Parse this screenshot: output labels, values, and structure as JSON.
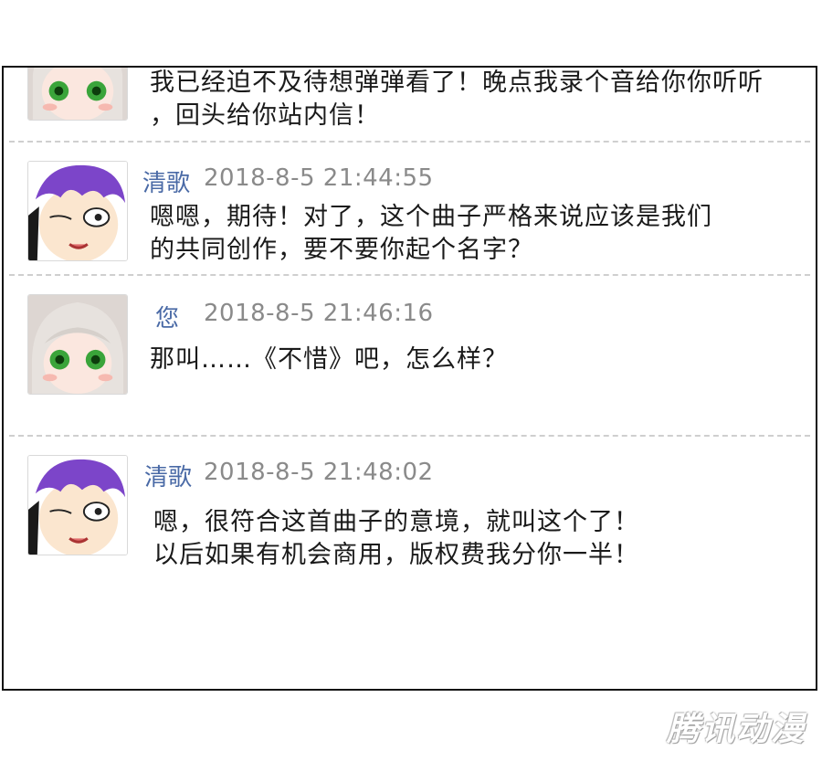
{
  "messages": [
    {
      "sender": "",
      "time": "",
      "avatar": "user-avatar",
      "lines": [
        "我已经迫不及待想弹弹看了！晚点我录个音给你你听听",
        "，回头给你站内信！"
      ]
    },
    {
      "sender": "清歌",
      "time": "2018-8-5 21:44:55",
      "avatar": "qingge-avatar",
      "lines": [
        "嗯嗯，期待！对了，这个曲子严格来说应该是我们",
        "的共同创作，要不要你起个名字？"
      ]
    },
    {
      "sender": "您",
      "time": "2018-8-5 21:46:16",
      "avatar": "user-avatar",
      "lines": [
        "那叫……《不惜》吧，怎么样？"
      ]
    },
    {
      "sender": "清歌",
      "time": "2018-8-5 21:48:02",
      "avatar": "qingge-avatar",
      "lines": [
        "嗯，很符合这首曲子的意境，就叫这个了！",
        "以后如果有机会商用，版权费我分你一半！"
      ]
    }
  ],
  "watermark": "腾讯动漫",
  "colors": {
    "sender": "#4a6aa6",
    "time": "#8a8a8a",
    "divider": "#cfcfcf"
  }
}
